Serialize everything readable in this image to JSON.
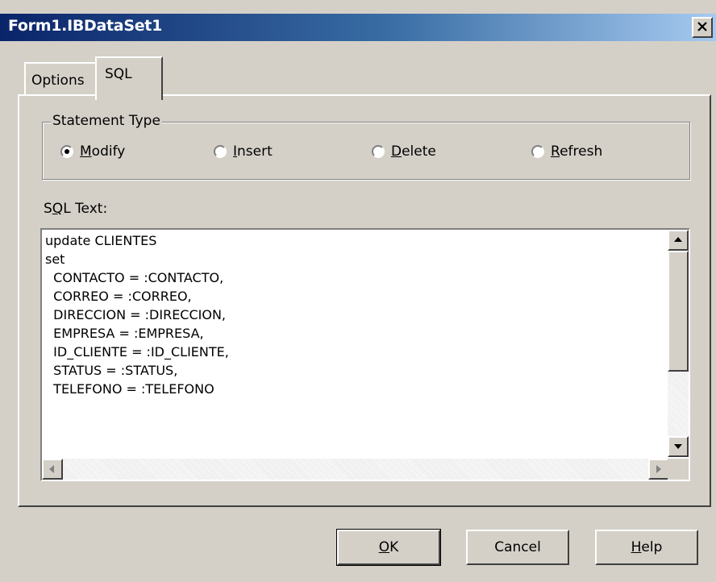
{
  "window": {
    "title": "Form1.IBDataSet1",
    "close_glyph": "X"
  },
  "tabs": [
    {
      "label": "Options",
      "active": false
    },
    {
      "label": "SQL",
      "active": true
    }
  ],
  "statement_type": {
    "legend": "Statement Type",
    "selected": "Modify",
    "options": [
      {
        "mnemonic": "M",
        "rest": "odify",
        "selected": true
      },
      {
        "mnemonic": "I",
        "rest": "nsert",
        "selected": false
      },
      {
        "mnemonic": "D",
        "rest": "elete",
        "selected": false
      },
      {
        "mnemonic": "R",
        "rest": "efresh",
        "selected": false
      }
    ]
  },
  "sql_text": {
    "label_prefix": "S",
    "label_mnemonic": "Q",
    "label_suffix": "L Text:",
    "lines": [
      "update CLIENTES",
      "set",
      "  CONTACTO = :CONTACTO,",
      "  CORREO = :CORREO,",
      "  DIRECCION = :DIRECCION,",
      "  EMPRESA = :EMPRESA,",
      "  ID_CLIENTE = :ID_CLIENTE,",
      "  STATUS = :STATUS,",
      "  TELEFONO = :TELEFONO"
    ]
  },
  "buttons": {
    "ok_mnemonic": "O",
    "ok_rest": "K",
    "cancel": "Cancel",
    "help_mnemonic": "H",
    "help_rest": "elp"
  },
  "icons": [
    "close-icon",
    "scroll-up-arrow-icon",
    "scroll-down-arrow-icon",
    "scroll-left-arrow-icon",
    "scroll-right-arrow-icon"
  ]
}
